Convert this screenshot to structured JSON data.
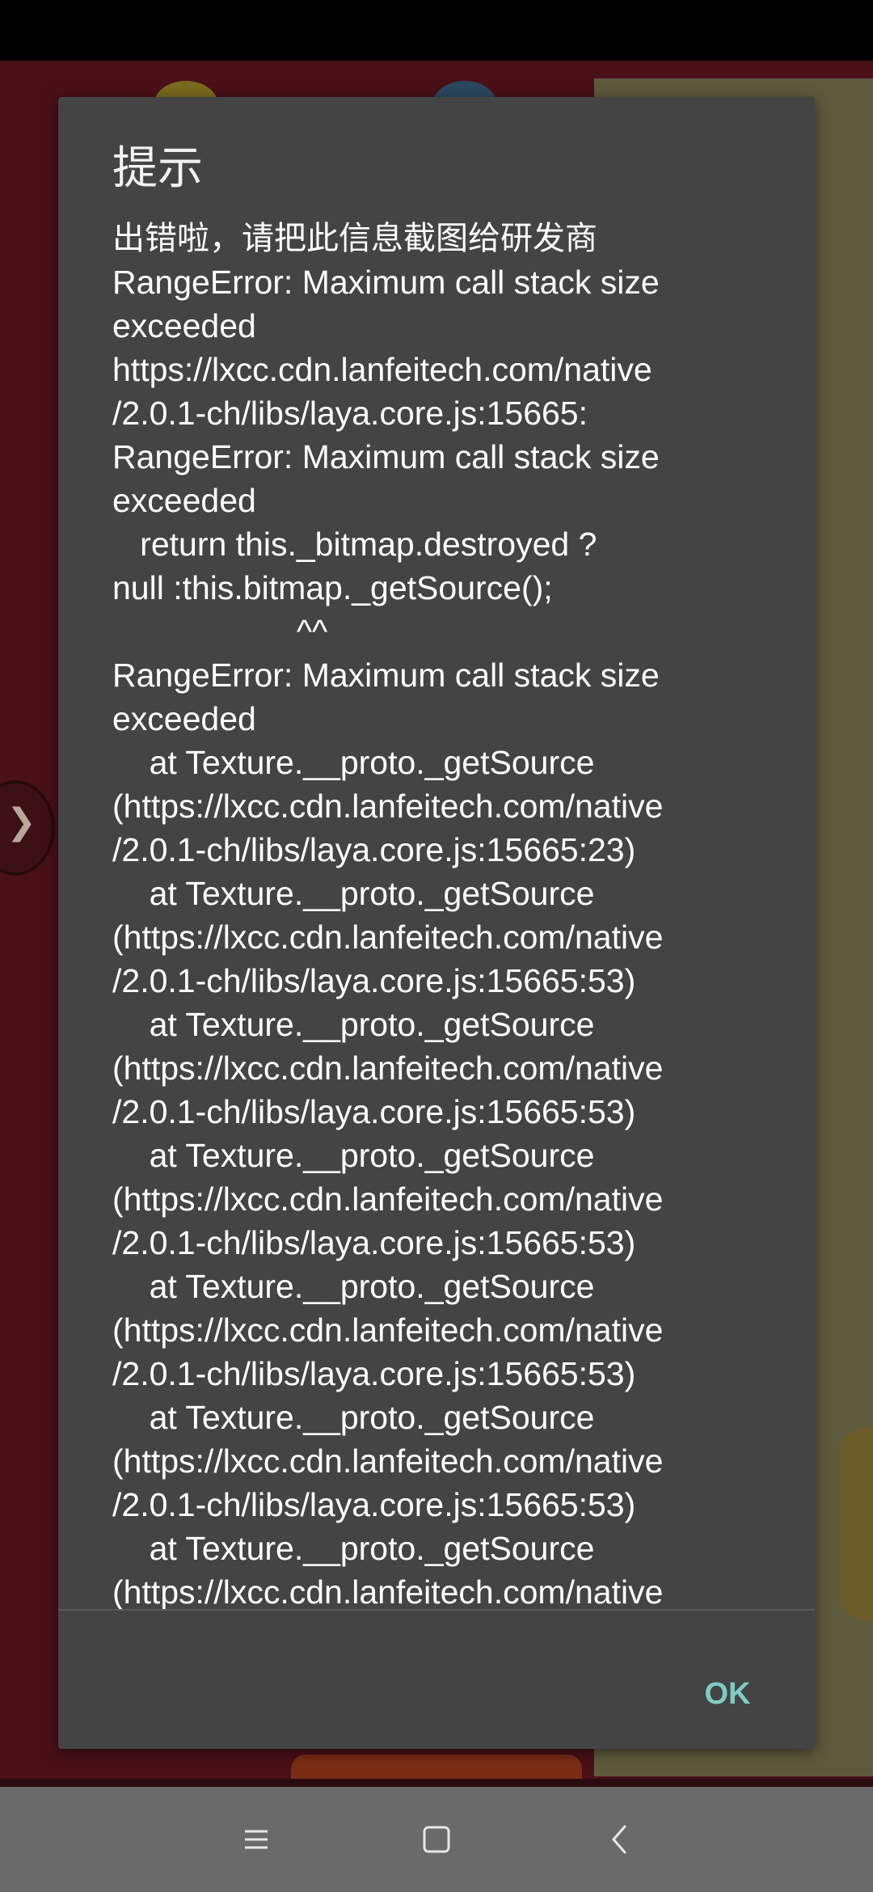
{
  "dialog": {
    "title": "提示",
    "message_lines": [
      "出错啦，请把此信息截图给研发商",
      "RangeError: Maximum call stack size",
      "exceeded",
      "https://lxcc.cdn.lanfeitech.com/native",
      "/2.0.1-ch/libs/laya.core.js:15665:",
      "RangeError: Maximum call stack size",
      "exceeded",
      "   return this._bitmap.destroyed ?",
      "null :this.bitmap._getSource();",
      "                    ^^",
      "RangeError: Maximum call stack size",
      "exceeded",
      "    at Texture.__proto._getSource",
      "(https://lxcc.cdn.lanfeitech.com/native",
      "/2.0.1-ch/libs/laya.core.js:15665:23)",
      "    at Texture.__proto._getSource",
      "(https://lxcc.cdn.lanfeitech.com/native",
      "/2.0.1-ch/libs/laya.core.js:15665:53)",
      "    at Texture.__proto._getSource",
      "(https://lxcc.cdn.lanfeitech.com/native",
      "/2.0.1-ch/libs/laya.core.js:15665:53)",
      "    at Texture.__proto._getSource",
      "(https://lxcc.cdn.lanfeitech.com/native",
      "/2.0.1-ch/libs/laya.core.js:15665:53)",
      "    at Texture.__proto._getSource",
      "(https://lxcc.cdn.lanfeitech.com/native",
      "/2.0.1-ch/libs/laya.core.js:15665:53)",
      "    at Texture.__proto._getSource",
      "(https://lxcc.cdn.lanfeitech.com/native",
      "/2.0.1-ch/libs/laya.core.js:15665:53)",
      "    at Texture.__proto._getSource",
      "(https://lxcc.cdn.lanfeitech.com/native"
    ],
    "ok_label": "OK"
  },
  "colors": {
    "dialog_background": "#444444",
    "accent": "#80cbc4",
    "nav_bar": "#6a6a6a"
  },
  "nav_bar": {
    "icons": [
      "menu-icon",
      "home-square-icon",
      "back-chevron-icon"
    ]
  }
}
